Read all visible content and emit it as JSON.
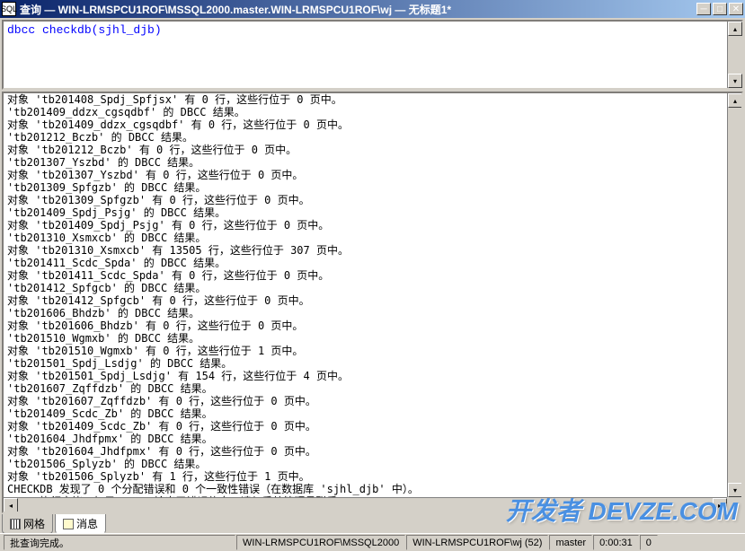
{
  "title": "查询 — WIN-LRMSPCU1ROF\\MSSQL2000.master.WIN-LRMSPCU1ROF\\wj — 无标题1*",
  "query": "dbcc checkdb(sjhl_djb)",
  "results": [
    "对象 'tb201408_Spdj_Spfjsx' 有 0 行，这些行位于 0 页中。",
    "'tb201409_ddzx_cgsqdbf' 的 DBCC 结果。",
    "对象 'tb201409_ddzx_cgsqdbf' 有 0 行，这些行位于 0 页中。",
    "'tb201212_Bczb' 的 DBCC 结果。",
    "对象 'tb201212_Bczb' 有 0 行，这些行位于 0 页中。",
    "'tb201307_Yszbd' 的 DBCC 结果。",
    "对象 'tb201307_Yszbd' 有 0 行，这些行位于 0 页中。",
    "'tb201309_Spfgzb' 的 DBCC 结果。",
    "对象 'tb201309_Spfgzb' 有 0 行，这些行位于 0 页中。",
    "'tb201409_Spdj_Psjg' 的 DBCC 结果。",
    "对象 'tb201409_Spdj_Psjg' 有 0 行，这些行位于 0 页中。",
    "'tb201310_Xsmxcb' 的 DBCC 结果。",
    "对象 'tb201310_Xsmxcb' 有 13505 行，这些行位于 307 页中。",
    "'tb201411_Scdc_Spda' 的 DBCC 结果。",
    "对象 'tb201411_Scdc_Spda' 有 0 行，这些行位于 0 页中。",
    "'tb201412_Spfgcb' 的 DBCC 结果。",
    "对象 'tb201412_Spfgcb' 有 0 行，这些行位于 0 页中。",
    "'tb201606_Bhdzb' 的 DBCC 结果。",
    "对象 'tb201606_Bhdzb' 有 0 行，这些行位于 0 页中。",
    "'tb201510_Wgmxb' 的 DBCC 结果。",
    "对象 'tb201510_Wgmxb' 有 0 行，这些行位于 1 页中。",
    "'tb201501_Spdj_Lsdjg' 的 DBCC 结果。",
    "对象 'tb201501_Spdj_Lsdjg' 有 154 行，这些行位于 4 页中。",
    "'tb201607_Zqffdzb' 的 DBCC 结果。",
    "对象 'tb201607_Zqffdzb' 有 0 行，这些行位于 0 页中。",
    "'tb201409_Scdc_Zb' 的 DBCC 结果。",
    "对象 'tb201409_Scdc_Zb' 有 0 行，这些行位于 0 页中。",
    "'tb201604_Jhdfpmx' 的 DBCC 结果。",
    "对象 'tb201604_Jhdfpmx' 有 0 行，这些行位于 0 页中。",
    "'tb201506_Splyzb' 的 DBCC 结果。",
    "对象 'tb201506_Splyzb' 有 1 行，这些行位于 1 页中。",
    "CHECKDB 发现了 0 个分配错误和 0 个一致性错误（在数据库 'sjhl_djb' 中）。",
    "DBCC 执行完毕。如果 DBCC 输出了错误信息，请与系统管理员联系。"
  ],
  "tabs": {
    "grid": "网格",
    "messages": "消息"
  },
  "status": {
    "msg": "批查询完成。",
    "server": "WIN-LRMSPCU1ROF\\MSSQL2000",
    "user": "WIN-LRMSPCU1ROF\\wj (52)",
    "db": "master",
    "time": "0:00:31",
    "rows": "0"
  },
  "watermark": "开发者 DEVZE.COM"
}
